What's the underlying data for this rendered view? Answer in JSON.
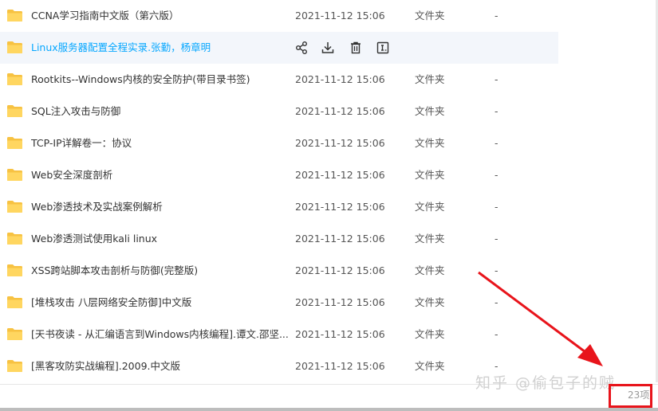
{
  "files": [
    {
      "name": "CCNA学习指南中文版（第六版）",
      "date": "2021-11-12 15:06",
      "type": "文件夹",
      "size": "-"
    },
    {
      "name": "Linux服务器配置全程实录.张勤，杨章明",
      "date": "",
      "type": "",
      "size": "",
      "hovered": true
    },
    {
      "name": "Rootkits--Windows内核的安全防护(带目录书签)",
      "date": "2021-11-12 15:06",
      "type": "文件夹",
      "size": "-"
    },
    {
      "name": "SQL注入攻击与防御",
      "date": "2021-11-12 15:06",
      "type": "文件夹",
      "size": "-"
    },
    {
      "name": "TCP-IP详解卷一：协议",
      "date": "2021-11-12 15:06",
      "type": "文件夹",
      "size": "-"
    },
    {
      "name": "Web安全深度剖析",
      "date": "2021-11-12 15:06",
      "type": "文件夹",
      "size": "-"
    },
    {
      "name": "Web渗透技术及实战案例解析",
      "date": "2021-11-12 15:06",
      "type": "文件夹",
      "size": "-"
    },
    {
      "name": "Web渗透测试使用kali linux",
      "date": "2021-11-12 15:06",
      "type": "文件夹",
      "size": "-"
    },
    {
      "name": "XSS跨站脚本攻击剖析与防御(完整版)",
      "date": "2021-11-12 15:06",
      "type": "文件夹",
      "size": "-"
    },
    {
      "name": "[堆栈攻击 八层网络安全防御]中文版",
      "date": "2021-11-12 15:06",
      "type": "文件夹",
      "size": "-"
    },
    {
      "name": "[天书夜读 - 从汇编语言到Windows内核编程].谭文.邵坚...",
      "date": "2021-11-12 15:06",
      "type": "文件夹",
      "size": "-"
    },
    {
      "name": "[黑客攻防实战编程].2009.中文版",
      "date": "2021-11-12 15:06",
      "type": "文件夹",
      "size": "-"
    }
  ],
  "row_actions": [
    "share-icon",
    "download-icon",
    "delete-icon",
    "rename-icon"
  ],
  "footer": {
    "count": "23项"
  },
  "watermark": "知乎 @偷包子的贼",
  "colors": {
    "folder": "#f7c242",
    "hover_text": "#06a7ff",
    "annotation": "#e8141b"
  }
}
